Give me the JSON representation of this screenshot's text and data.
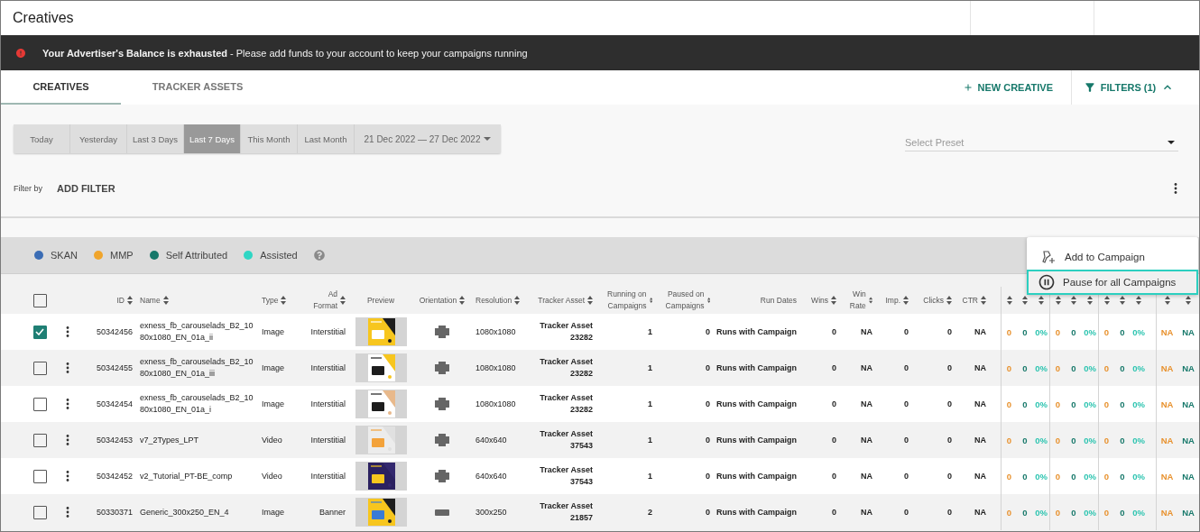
{
  "page": {
    "title": "Creatives"
  },
  "alert": {
    "message": "**Your Advertiser's Balance is exhausted** - Please add funds to your account to keep your campaigns running"
  },
  "tabs": [
    {
      "label": "CREATIVES",
      "selected": true
    },
    {
      "label": "TRACKER ASSETS",
      "selected": false
    }
  ],
  "actions": {
    "new_creative": "NEW CREATIVE",
    "filters": "FILTERS (1)",
    "filters_expanded": true
  },
  "date_ranges": [
    {
      "label": "Today",
      "selected": false
    },
    {
      "label": "Yesterday",
      "selected": false
    },
    {
      "label": "Last 3 Days",
      "selected": false
    },
    {
      "label": "Last 7 Days",
      "selected": true
    },
    {
      "label": "This Month",
      "selected": false
    },
    {
      "label": "Last Month",
      "selected": false
    }
  ],
  "date_picker": {
    "value": "21 Dec 2022 — 27 Dec 2022"
  },
  "preset": {
    "placeholder": "Select Preset"
  },
  "filter_row": {
    "label": "Filter by",
    "add": "ADD FILTER"
  },
  "legend": [
    {
      "label": "SKAN",
      "color": "#3b6db5"
    },
    {
      "label": "MMP",
      "color": "#f0a52c"
    },
    {
      "label": "Self Attributed",
      "color": "#16786a"
    },
    {
      "label": "Assisted",
      "color": "#2fd6c4"
    }
  ],
  "menu": [
    {
      "label": "Add to Campaign",
      "kind": "add",
      "selected": false
    },
    {
      "label": "Pause for all Campaigns",
      "kind": "pause",
      "selected": true
    }
  ],
  "table": {
    "all_checked": false,
    "columns": [
      {
        "label": "ID",
        "sortable": true
      },
      {
        "label": "Name",
        "sortable": true
      },
      {
        "label": "Type",
        "sortable": true
      },
      {
        "label": "Ad Format",
        "sortable": true
      },
      {
        "label": "Preview",
        "sortable": false
      },
      {
        "label": "Orientation",
        "sortable": true
      },
      {
        "label": "Resolution",
        "sortable": true
      },
      {
        "label": "Tracker Asset",
        "sortable": true
      },
      {
        "label": "Running on Campaigns",
        "sortable": true
      },
      {
        "label": "Paused on Campaigns",
        "sortable": true
      },
      {
        "label": "Run Dates",
        "sortable": false
      },
      {
        "label": "Wins",
        "sortable": true
      },
      {
        "label": "Win Rate",
        "sortable": true
      },
      {
        "label": "Imp.",
        "sortable": true
      },
      {
        "label": "Clicks",
        "sortable": true
      },
      {
        "label": "CTR",
        "sortable": true
      }
    ],
    "metric_columns": [
      {
        "kind": "mmp"
      },
      {
        "kind": "self"
      },
      {
        "kind": "assisted"
      },
      {
        "kind": "mmp"
      },
      {
        "kind": "self"
      },
      {
        "kind": "assisted"
      },
      {
        "kind": "mmp"
      },
      {
        "kind": "self"
      },
      {
        "kind": "assisted"
      },
      {
        "kind": "mmp"
      },
      {
        "kind": "self"
      }
    ],
    "rows": [
      {
        "checked": true,
        "id": "50342456",
        "name": "exness_fb_carouselads_B2_1080x1080_EN_01a_ii",
        "type": "Image",
        "ad_format": "Interstitial",
        "orientation": {
          "kind": "square"
        },
        "resolution": "1080x1080",
        "tracker_asset": "Tracker Asset 23282",
        "running": "1",
        "paused": "0",
        "run_dates": "Runs with Campaign",
        "wins": "0",
        "win_rate": "NA",
        "imp": "0",
        "clicks": "0",
        "ctr": "NA",
        "metrics": [
          "0",
          "0",
          "0%",
          "0",
          "0",
          "0%",
          "0",
          "0",
          "0%",
          "NA",
          "NA"
        ]
      },
      {
        "checked": false,
        "id": "50342455",
        "name": "exness_fb_carouselads_B2_1080x1080_EN_01a_iii",
        "type": "Image",
        "ad_format": "Interstitial",
        "orientation": {
          "kind": "square"
        },
        "resolution": "1080x1080",
        "tracker_asset": "Tracker Asset 23282",
        "running": "1",
        "paused": "0",
        "run_dates": "Runs with Campaign",
        "wins": "0",
        "win_rate": "NA",
        "imp": "0",
        "clicks": "0",
        "ctr": "NA",
        "metrics": [
          "0",
          "0",
          "0%",
          "0",
          "0",
          "0%",
          "0",
          "0",
          "0%",
          "NA",
          "NA"
        ]
      },
      {
        "checked": false,
        "id": "50342454",
        "name": "exness_fb_carouselads_B2_1080x1080_EN_01a_i",
        "type": "Image",
        "ad_format": "Interstitial",
        "orientation": {
          "kind": "square"
        },
        "resolution": "1080x1080",
        "tracker_asset": "Tracker Asset 23282",
        "running": "1",
        "paused": "0",
        "run_dates": "Runs with Campaign",
        "wins": "0",
        "win_rate": "NA",
        "imp": "0",
        "clicks": "0",
        "ctr": "NA",
        "metrics": [
          "0",
          "0",
          "0%",
          "0",
          "0",
          "0%",
          "0",
          "0",
          "0%",
          "NA",
          "NA"
        ]
      },
      {
        "checked": false,
        "id": "50342453",
        "name": "v7_2Types_LPT",
        "type": "Video",
        "ad_format": "Interstitial",
        "orientation": {
          "kind": "square"
        },
        "resolution": "640x640",
        "tracker_asset": "Tracker Asset 37543",
        "running": "1",
        "paused": "0",
        "run_dates": "Runs with Campaign",
        "wins": "0",
        "win_rate": "NA",
        "imp": "0",
        "clicks": "0",
        "ctr": "NA",
        "metrics": [
          "0",
          "0",
          "0%",
          "0",
          "0",
          "0%",
          "0",
          "0",
          "0%",
          "NA",
          "NA"
        ]
      },
      {
        "checked": false,
        "id": "50342452",
        "name": "v2_Tutorial_PT-BE_comp",
        "type": "Video",
        "ad_format": "Interstitial",
        "orientation": {
          "kind": "square"
        },
        "resolution": "640x640",
        "tracker_asset": "Tracker Asset 37543",
        "running": "1",
        "paused": "0",
        "run_dates": "Runs with Campaign",
        "wins": "0",
        "win_rate": "NA",
        "imp": "0",
        "clicks": "0",
        "ctr": "NA",
        "metrics": [
          "0",
          "0",
          "0%",
          "0",
          "0",
          "0%",
          "0",
          "0",
          "0%",
          "NA",
          "NA"
        ]
      },
      {
        "checked": false,
        "id": "50330371",
        "name": "Generic_300x250_EN_4",
        "type": "Image",
        "ad_format": "Banner",
        "orientation": {
          "kind": "banner"
        },
        "resolution": "300x250",
        "tracker_asset": "Tracker Asset 21857",
        "running": "2",
        "paused": "0",
        "run_dates": "Runs with Campaign",
        "wins": "0",
        "win_rate": "NA",
        "imp": "0",
        "clicks": "0",
        "ctr": "NA",
        "metrics": [
          "0",
          "0",
          "0%",
          "0",
          "0",
          "0%",
          "0",
          "0",
          "0%",
          "NA",
          "NA"
        ]
      }
    ]
  }
}
